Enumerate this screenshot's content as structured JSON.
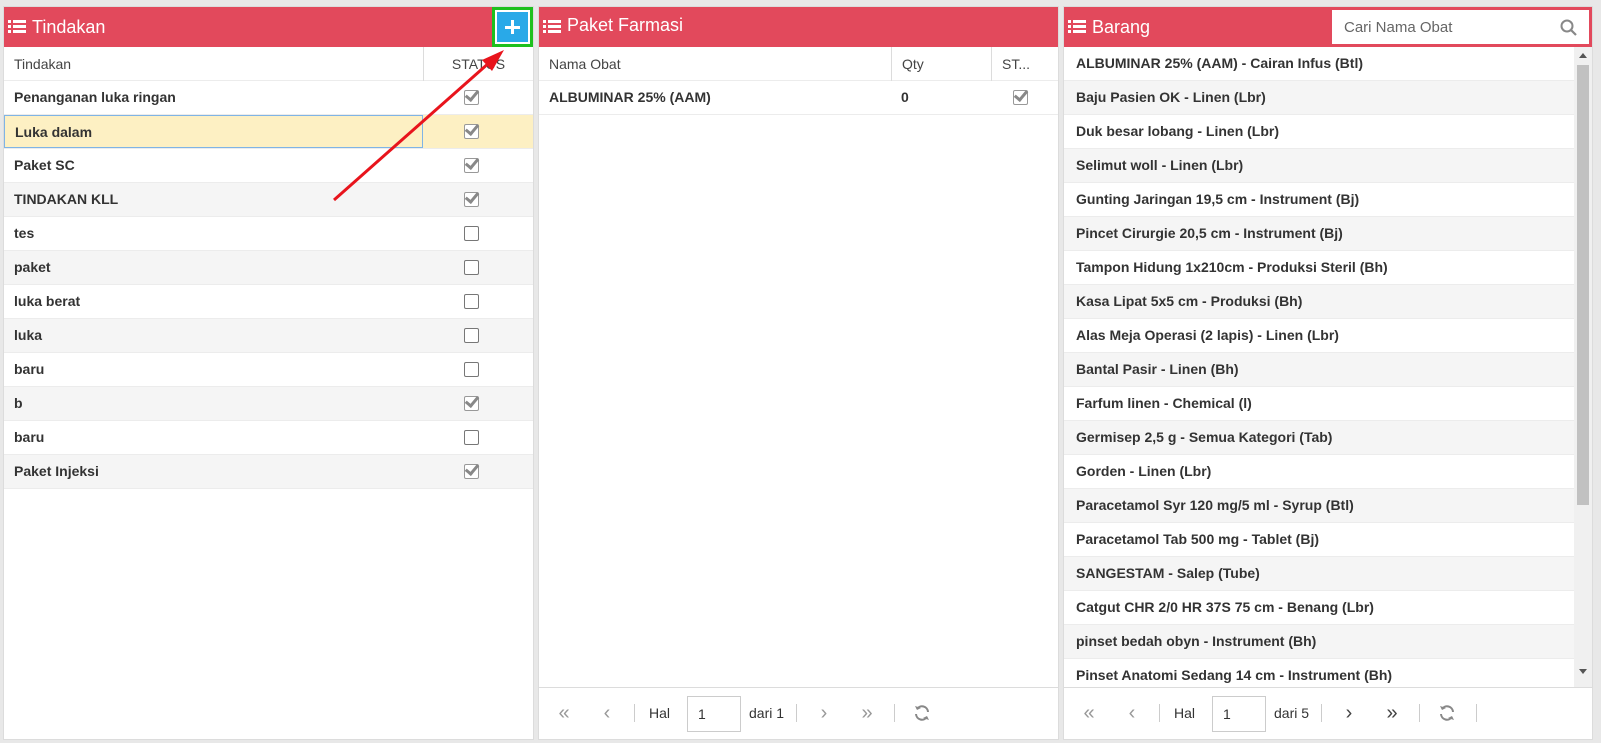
{
  "tindakan": {
    "title": "Tindakan",
    "columns": [
      "Tindakan",
      "STATUS"
    ],
    "rows": [
      {
        "name": "Penanganan luka ringan",
        "status": true
      },
      {
        "name": "Luka dalam",
        "status": true,
        "selected": true
      },
      {
        "name": "Paket SC",
        "status": true
      },
      {
        "name": "TINDAKAN KLL",
        "status": true
      },
      {
        "name": "tes",
        "status": false
      },
      {
        "name": "paket",
        "status": false
      },
      {
        "name": "luka berat",
        "status": false
      },
      {
        "name": "luka",
        "status": false
      },
      {
        "name": "baru",
        "status": false
      },
      {
        "name": "b",
        "status": true
      },
      {
        "name": "baru",
        "status": false
      },
      {
        "name": "Paket Injeksi",
        "status": true
      }
    ]
  },
  "paket": {
    "title": "Paket Farmasi",
    "columns": [
      "Nama Obat",
      "Qty",
      "ST..."
    ],
    "rows": [
      {
        "name": "ALBUMINAR 25% (AAM)",
        "qty": "0",
        "status": true
      }
    ],
    "pager": {
      "hal_label": "Hal",
      "page": "1",
      "of_label": "dari 1"
    }
  },
  "barang": {
    "title": "Barang",
    "search_placeholder": "Cari Nama Obat",
    "items": [
      "ALBUMINAR 25% (AAM) - Cairan Infus (Btl)",
      "Baju Pasien OK - Linen (Lbr)",
      "Duk besar lobang - Linen (Lbr)",
      "Selimut woll - Linen (Lbr)",
      "Gunting Jaringan 19,5 cm - Instrument (Bj)",
      "Pincet Cirurgie 20,5 cm - Instrument (Bj)",
      "Tampon Hidung 1x210cm - Produksi Steril (Bh)",
      "Kasa Lipat 5x5 cm - Produksi (Bh)",
      "Alas Meja Operasi (2 lapis) - Linen (Lbr)",
      "Bantal Pasir - Linen (Bh)",
      "Farfum linen - Chemical (l)",
      "Germisep 2,5 g - Semua Kategori (Tab)",
      "Gorden - Linen (Lbr)",
      "Paracetamol Syr 120 mg/5 ml - Syrup (Btl)",
      "Paracetamol Tab 500 mg - Tablet (Bj)",
      "SANGESTAM - Salep (Tube)",
      "Catgut CHR 2/0 HR 37S 75 cm - Benang (Lbr)",
      "pinset bedah obyn - Instrument (Bh)",
      "Pinset Anatomi Sedang 14 cm - Instrument (Bh)"
    ],
    "pager": {
      "hal_label": "Hal",
      "page": "1",
      "of_label": "dari 5"
    }
  },
  "icons": {
    "menu": "list-icon",
    "add": "plus-icon",
    "search": "search-icon",
    "refresh": "refresh-icon",
    "annotation": "red-arrow"
  },
  "colors": {
    "header": "#e2495c",
    "add_button": "#29a9e8",
    "highlight_border": "#1ec01e",
    "selected_row": "#fdf0c3",
    "annotation_arrow": "#e8141c"
  }
}
